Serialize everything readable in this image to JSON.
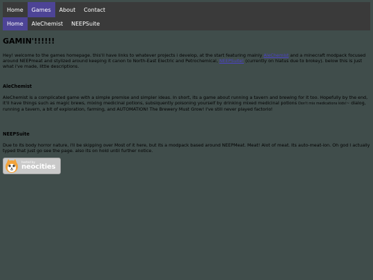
{
  "topnav": {
    "items": [
      {
        "label": "Home",
        "active": false
      },
      {
        "label": "Games",
        "active": true
      },
      {
        "label": "About",
        "active": false
      },
      {
        "label": "Contact",
        "active": false
      }
    ]
  },
  "subnav": {
    "items": [
      {
        "label": "Home",
        "active": true
      },
      {
        "label": "AleChemist",
        "active": false
      },
      {
        "label": "NEEPSuite",
        "active": false
      }
    ]
  },
  "main": {
    "title": "GAMIN'!!!!!!",
    "intro": {
      "text_1": "Hey! welcome to the games homepage. this'll have links to whatever projects i develop, at the start featuring mainly ",
      "link_1": "AleChemist",
      "text_2": " and a minecraft modpack focused around NEEPmeat and stylized around keeping it canon to North-East Electric and Petrochemical, ",
      "link_2": "NEEPSuite!",
      "text_3": " (currently on hiatus due to brokey). below this is just what i've made, little descriptions."
    },
    "alechemist": {
      "heading": "AleChemist",
      "text_1": "AleChemist is a complicated game with a simple premise and simpler ideas. In short, its a game about running a tavern and brewing for it too. Hopefully by the end, it'll have things such as magic brews, mixing medicinal potions, subsiquently poisoning yourself by drinking mixed medicinal potions ",
      "small_text": "Don't mix medications kids!~",
      "text_2": " dialog, running a tavern, a bit of exploration, farming, and AUTOMATION! The Brewery Must Grow! I've still never played factorio!"
    },
    "neepsuite": {
      "heading": "NEEPSuite",
      "text": "Due to its body horror nature, i'll be skipping over Most of it here, but its a modpack based around NEEPMeat. Meat! Alot of meat. Its auto-meat-ion. Oh god I actually typed that just go see the page. also its on hold until further notice."
    },
    "badge": {
      "small": "hosted by",
      "big": "neocities"
    }
  },
  "colors": {
    "background": "#404d4b",
    "nav": "#3a3a3a",
    "nav_active": "#4d4496",
    "link": "#4b43c7"
  }
}
